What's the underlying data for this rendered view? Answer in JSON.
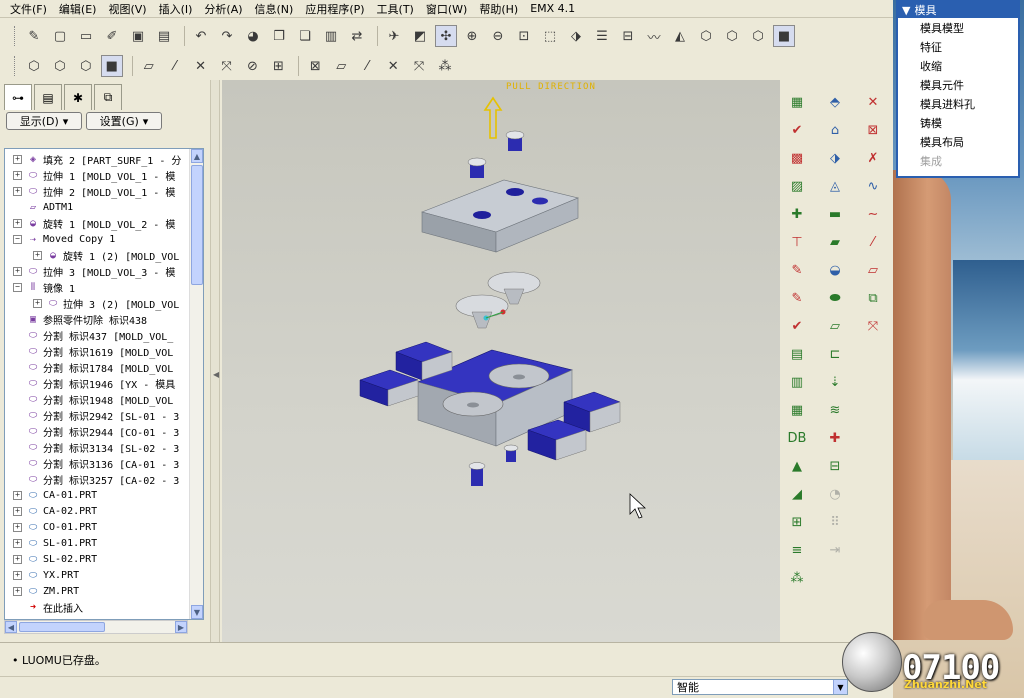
{
  "menubar": {
    "items": [
      "文件(F)",
      "编辑(E)",
      "视图(V)",
      "插入(I)",
      "分析(A)",
      "信息(N)",
      "应用程序(P)",
      "工具(T)",
      "窗口(W)",
      "帮助(H)",
      "EMX 4.1"
    ]
  },
  "model_tree": {
    "show_button": "显示(D)",
    "settings_button": "设置(G)",
    "items": [
      {
        "text": "填充 2 [PART_SURF_1 - 分",
        "icon": "fill-feature-icon"
      },
      {
        "text": "拉伸 1 [MOLD_VOL_1 - 模",
        "icon": "extrude-icon"
      },
      {
        "text": "拉伸 2 [MOLD_VOL_1 - 模",
        "icon": "extrude-icon"
      },
      {
        "text": "ADTM1",
        "icon": "datum-plane-icon"
      },
      {
        "text": "旋转 1 [MOLD_VOL_2 - 模",
        "icon": "revolve-icon"
      },
      {
        "text": "Moved Copy 1",
        "icon": "moved-copy-icon"
      },
      {
        "text": "旋转 1 (2) [MOLD_VOL",
        "icon": "revolve-icon"
      },
      {
        "text": "拉伸 3 [MOLD_VOL_3 - 模",
        "icon": "extrude-icon"
      },
      {
        "text": "镜像 1",
        "icon": "mirror-icon"
      },
      {
        "text": "拉伸 3 (2) [MOLD_VOL",
        "icon": "extrude-icon"
      },
      {
        "text": "参照零件切除 标识438",
        "icon": "ref-part-cutout-icon"
      },
      {
        "text": "分割 标识437 [MOLD_VOL_",
        "icon": "split-icon"
      },
      {
        "text": "分割 标识1619 [MOLD_VOL",
        "icon": "split-icon"
      },
      {
        "text": "分割 标识1784 [MOLD_VOL",
        "icon": "split-icon"
      },
      {
        "text": "分割 标识1946 [YX - 模具",
        "icon": "split-icon"
      },
      {
        "text": "分割 标识1948 [MOLD_VOL",
        "icon": "split-icon"
      },
      {
        "text": "分割 标识2942 [SL-01 - 3",
        "icon": "split-icon"
      },
      {
        "text": "分割 标识2944 [CO-01 - 3",
        "icon": "split-icon"
      },
      {
        "text": "分割 标识3134 [SL-02 - 3",
        "icon": "split-icon"
      },
      {
        "text": "分割 标识3136 [CA-01 - 3",
        "icon": "split-icon"
      },
      {
        "text": "分割 标识3257 [CA-02 - 3",
        "icon": "split-icon"
      },
      {
        "text": "CA-01.PRT",
        "icon": "part-icon"
      },
      {
        "text": "CA-02.PRT",
        "icon": "part-icon"
      },
      {
        "text": "CO-01.PRT",
        "icon": "part-icon"
      },
      {
        "text": "SL-01.PRT",
        "icon": "part-icon"
      },
      {
        "text": "SL-02.PRT",
        "icon": "part-icon"
      },
      {
        "text": "YX.PRT",
        "icon": "part-icon"
      },
      {
        "text": "ZM.PRT",
        "icon": "part-icon"
      },
      {
        "text": "在此插入",
        "icon": "insert-here-arrow-icon"
      }
    ]
  },
  "viewport": {
    "pull_direction_label": "PULL DIRECTION",
    "colors": {
      "mold_plate": "#a7adb5",
      "insert_blue": "#2c2cb0",
      "pull_arrow": "#e6c200"
    }
  },
  "popup_menu": {
    "title": "模具",
    "items": [
      {
        "label": "模具模型",
        "enabled": true
      },
      {
        "label": "特征",
        "enabled": true
      },
      {
        "label": "收缩",
        "enabled": true
      },
      {
        "label": "模具元件",
        "enabled": true
      },
      {
        "label": "模具进料孔",
        "enabled": true
      },
      {
        "label": "铸模",
        "enabled": true
      },
      {
        "label": "模具布局",
        "enabled": true
      },
      {
        "label": "集成",
        "enabled": false
      }
    ]
  },
  "message_area": {
    "text": "LUOMU已存盘。"
  },
  "status_bar": {
    "filter_value": "智能"
  },
  "watermark": {
    "number": "07100",
    "site": "Zhuanzhi.Net"
  }
}
